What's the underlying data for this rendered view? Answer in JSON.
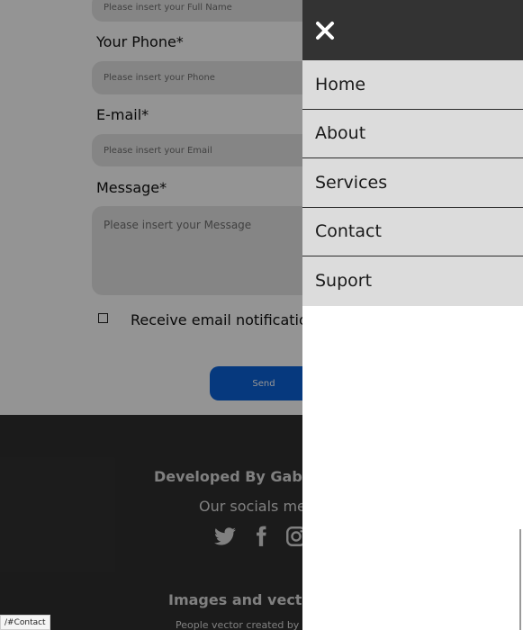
{
  "form": {
    "name_placeholder": "Please insert your Full Name",
    "phone_label": "Your Phone*",
    "phone_placeholder": "Please insert your Phone",
    "email_label": "E-mail*",
    "email_placeholder": "Please insert your Email",
    "message_label": "Message*",
    "message_placeholder": "Please insert your Message",
    "notifications_label": "Receive email notifications",
    "send_label": "Send"
  },
  "footer": {
    "developed_by": "Developed By Gabriel",
    "socials": "Our socials med",
    "social_icons": [
      "twitter-icon",
      "facebook-icon",
      "instagram-icon"
    ],
    "images_vectors": "Images and vectors",
    "credit": "People vector created by"
  },
  "menu": {
    "close_icon": "close-icon",
    "items": [
      {
        "label": "Home"
      },
      {
        "label": "About"
      },
      {
        "label": "Services"
      },
      {
        "label": "Contact"
      },
      {
        "label": "Suport"
      }
    ]
  },
  "status_bar": {
    "url": "/#Contact"
  },
  "colors": {
    "sidebar_header": "#333333",
    "menu_item_bg": "#dcdcdc",
    "send_button": "#0b62d9",
    "footer_bg": "#303030",
    "overlay": "rgba(0,0,0,0.42)"
  }
}
